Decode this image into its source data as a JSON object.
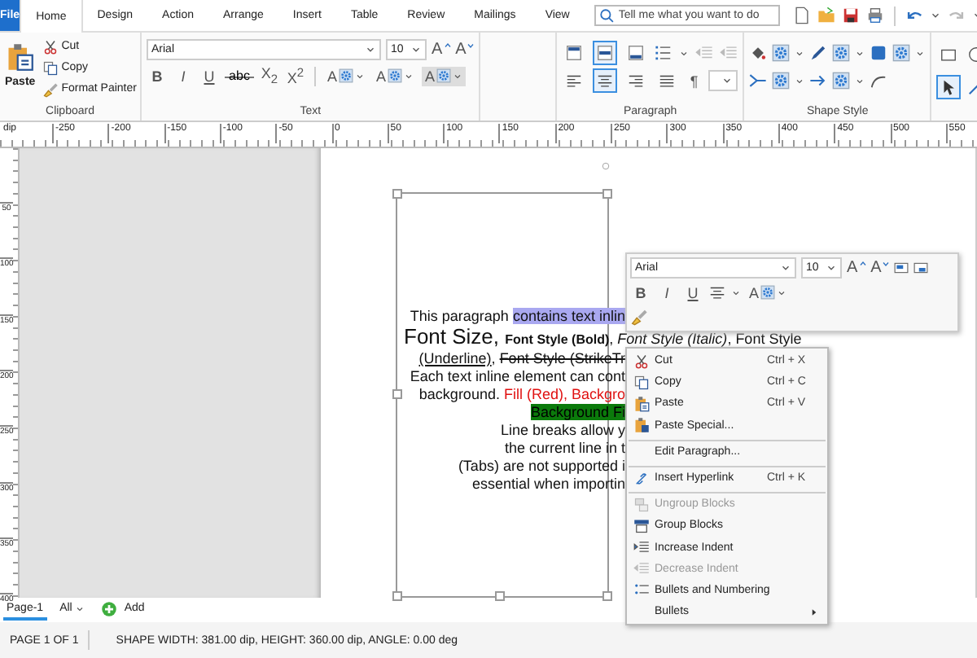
{
  "ribbon_tabs": [
    {
      "label": "File",
      "kind": "file",
      "selected": false
    },
    {
      "label": "Home",
      "kind": "tab",
      "selected": true
    },
    {
      "label": "Design",
      "kind": "tab",
      "selected": false
    },
    {
      "label": "Action",
      "kind": "tab",
      "selected": false
    },
    {
      "label": "Arrange",
      "kind": "tab",
      "selected": false
    },
    {
      "label": "Insert",
      "kind": "tab",
      "selected": false
    },
    {
      "label": "Table",
      "kind": "tab",
      "selected": false
    },
    {
      "label": "Review",
      "kind": "tab",
      "selected": false
    },
    {
      "label": "Mailings",
      "kind": "tab",
      "selected": false
    },
    {
      "label": "View",
      "kind": "tab",
      "selected": false
    }
  ],
  "search": {
    "placeholder": "Tell me what you want to do"
  },
  "clipboard": {
    "title": "Clipboard",
    "paste": "Paste",
    "actions": [
      "Cut",
      "Copy",
      "Format Painter"
    ]
  },
  "text_group": {
    "title": "Text",
    "font": "Arial",
    "size": "10",
    "grow": "A",
    "shrink": "A",
    "format_buttons": [
      {
        "label": "B",
        "kind": "bold"
      },
      {
        "label": "I",
        "kind": "italic"
      },
      {
        "label": "U",
        "kind": "underline"
      },
      {
        "label": "abc",
        "kind": "strike"
      },
      {
        "label": "X$_{2}$",
        "kind": "plain"
      },
      {
        "label": "X$^{2}$",
        "kind": "plain"
      }
    ],
    "color_buttons": [
      "A",
      "A",
      "A"
    ]
  },
  "paragraph_group": {
    "title": "Paragraph",
    "pilcrow": "¶",
    "vertical_align": [
      {
        "selected": false
      },
      {
        "selected": true
      },
      {
        "selected": false
      }
    ],
    "horizontal_align": [
      {
        "selected": false
      },
      {
        "selected": true
      },
      {
        "selected": false
      },
      {
        "selected": false
      }
    ]
  },
  "shape_style_group": {
    "title": "Shape Style"
  },
  "tools": [
    {
      "selected": false
    },
    {
      "selected": false
    },
    {
      "selected": true
    },
    {
      "selected": false
    }
  ],
  "ruler": {
    "unit": "dip",
    "horizontal": [
      "-250",
      "-200",
      "-150",
      "-100",
      "-50",
      "0",
      "50",
      "100",
      "150",
      "200",
      "250",
      "300",
      "350",
      "400",
      "450",
      "500",
      "550"
    ],
    "vertical": [
      "50",
      "100",
      "150",
      "200",
      "250",
      "300",
      "350",
      "400"
    ]
  },
  "document": {
    "lines": [
      {
        "kind": "clipped",
        "segments": [
          {
            "text": "This paragraph ",
            "kind": "plain"
          },
          {
            "text": "contains text inlin",
            "kind": "highlight"
          }
        ]
      },
      {
        "kind": "whole",
        "segments": [
          {
            "text": "Font Size, ",
            "kind": "large"
          },
          {
            "text": "**Font Style (Bold)**, *Font Style (Italic)*, Font Style",
            "kind": "rich"
          }
        ]
      },
      {
        "kind": "clipped",
        "segments": [
          {
            "text": "(Underline)",
            "kind": "underline"
          },
          {
            "text": ", ",
            "kind": "plain"
          },
          {
            "text": "Font Style (StrikeTr",
            "kind": "strike"
          }
        ]
      },
      {
        "kind": "clipped",
        "segments": [
          {
            "text": "Each text inline element can cont",
            "kind": "plain"
          }
        ]
      },
      {
        "kind": "clipped",
        "segments": [
          {
            "text": "background. ",
            "kind": "plain"
          },
          {
            "text": "Fill (Red), Backgro",
            "kind": "red"
          }
        ]
      },
      {
        "kind": "clipped",
        "segments": [
          {
            "text": "Background Fi",
            "kind": "green"
          }
        ]
      },
      {
        "kind": "clipped",
        "segments": [
          {
            "text": "Line breaks allow y",
            "kind": "plain"
          }
        ]
      },
      {
        "kind": "clipped",
        "segments": [
          {
            "text": "the current line in t",
            "kind": "plain"
          }
        ]
      },
      {
        "kind": "clipped",
        "segments": [
          {
            "text": "(Tabs) are not supported i",
            "kind": "plain"
          }
        ]
      },
      {
        "kind": "clipped",
        "segments": [
          {
            "text": "essential when importin",
            "kind": "plain"
          }
        ]
      }
    ]
  },
  "mini_toolbar": {
    "font": "Arial",
    "size": "10",
    "grow": "A",
    "shrink": "A",
    "format_buttons": [
      {
        "label": "B",
        "kind": "bold"
      },
      {
        "label": "I",
        "kind": "italic"
      },
      {
        "label": "U",
        "kind": "underline"
      }
    ],
    "color_button": "A"
  },
  "context_menu": {
    "items": [
      {
        "label": "Cut",
        "shortcut": "Ctrl + X",
        "disabled": false,
        "separator_before": false,
        "submenu": false
      },
      {
        "label": "Copy",
        "shortcut": "Ctrl + C",
        "disabled": false,
        "separator_before": false,
        "submenu": false
      },
      {
        "label": "Paste",
        "shortcut": "Ctrl + V",
        "disabled": false,
        "separator_before": false,
        "submenu": false
      },
      {
        "label": "Paste Special...",
        "disabled": false,
        "separator_before": false,
        "submenu": false
      },
      {
        "label": "Edit Paragraph...",
        "disabled": false,
        "separator_before": true,
        "submenu": false
      },
      {
        "label": "Insert Hyperlink",
        "shortcut": "Ctrl + K",
        "disabled": false,
        "separator_before": true,
        "submenu": false
      },
      {
        "label": "Ungroup Blocks",
        "disabled": true,
        "separator_before": true,
        "submenu": false
      },
      {
        "label": "Group Blocks",
        "disabled": false,
        "separator_before": false,
        "submenu": false
      },
      {
        "label": "Increase Indent",
        "disabled": false,
        "separator_before": false,
        "submenu": false
      },
      {
        "label": "Decrease Indent",
        "disabled": true,
        "separator_before": false,
        "submenu": false
      },
      {
        "label": "Bullets and Numbering",
        "disabled": false,
        "separator_before": false,
        "submenu": false
      },
      {
        "label": "Bullets",
        "disabled": false,
        "separator_before": false,
        "submenu": true
      }
    ]
  },
  "page_tabs": [
    {
      "label": "Page-1",
      "selected": true
    },
    {
      "label": "All",
      "selected": false
    }
  ],
  "add_page": "Add",
  "status_bar": {
    "page": "PAGE 1 OF 1",
    "shape": "SHAPE WIDTH: 381.00 dip, HEIGHT: 360.00 dip, ANGLE: 0.00 deg"
  }
}
